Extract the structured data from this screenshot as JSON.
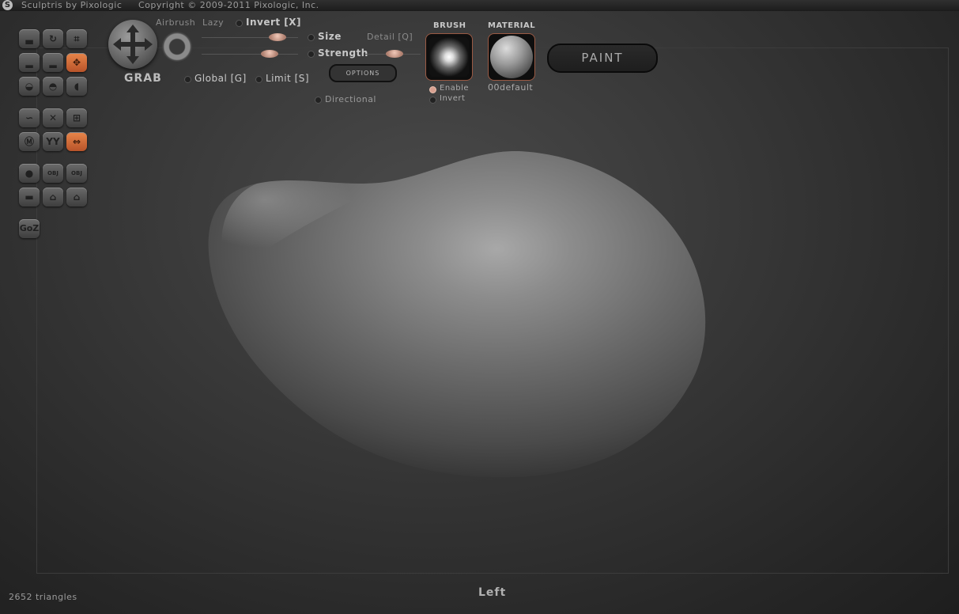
{
  "window": {
    "title": "Sculptris by Pixologic",
    "copyright": "Copyright © 2009-2011 Pixologic, Inc."
  },
  "tools": [
    {
      "name": "tool-draw",
      "glyph": "▃",
      "active": false
    },
    {
      "name": "tool-rotate",
      "glyph": "↻",
      "active": false
    },
    {
      "name": "tool-crop",
      "glyph": "⌗",
      "active": false
    },
    {
      "name": "tool-inflate",
      "glyph": "▂",
      "active": false
    },
    {
      "name": "tool-flatten",
      "glyph": "▂",
      "active": false
    },
    {
      "name": "tool-grab",
      "glyph": "✥",
      "active": true
    },
    {
      "name": "tool-pinch",
      "glyph": "◒",
      "active": false
    },
    {
      "name": "tool-crease",
      "glyph": "◓",
      "active": false
    },
    {
      "name": "tool-smooth",
      "glyph": "◖",
      "active": false
    },
    {
      "name": "tool-symmetry",
      "glyph": "∽",
      "active": false
    },
    {
      "name": "tool-wireframe",
      "glyph": "✕",
      "active": false
    },
    {
      "name": "tool-grid",
      "glyph": "⊞",
      "active": false
    },
    {
      "name": "tool-mask",
      "glyph": "Ⓜ",
      "active": false
    },
    {
      "name": "tool-reduce",
      "glyph": "ΥΥ",
      "active": false
    },
    {
      "name": "tool-mirror",
      "glyph": "⇔",
      "active": true
    },
    {
      "name": "tool-sphere",
      "glyph": "●",
      "active": false
    },
    {
      "name": "tool-import-obj",
      "glyph": "OBJ",
      "active": false
    },
    {
      "name": "tool-export-obj",
      "glyph": "OBJ",
      "active": false
    },
    {
      "name": "tool-plane",
      "glyph": "▬",
      "active": false
    },
    {
      "name": "tool-open",
      "glyph": "⌂",
      "active": false
    },
    {
      "name": "tool-save",
      "glyph": "⌂",
      "active": false
    }
  ],
  "goz_label": "GoZ",
  "brush": {
    "name": "GRAB",
    "airbrush_label": "Airbrush",
    "lazy_label": "Lazy",
    "invert_label": "Invert [X]",
    "size_label": "Size",
    "detail_label": "Detail [Q]",
    "strength_label": "Strength",
    "global_label": "Global [G]",
    "limit_label": "Limit [S]",
    "options_label": "OPTIONS",
    "directional_label": "Directional",
    "size_value": 0.85,
    "strength_value": 0.75,
    "detail_value": 0.55
  },
  "brush_panel": {
    "header": "BRUSH",
    "enable_label": "Enable",
    "invert_label": "Invert"
  },
  "material_panel": {
    "header": "MATERIAL",
    "name": "00default"
  },
  "paint_button": "PAINT",
  "status": {
    "triangles": "2652 triangles",
    "view": "Left"
  }
}
